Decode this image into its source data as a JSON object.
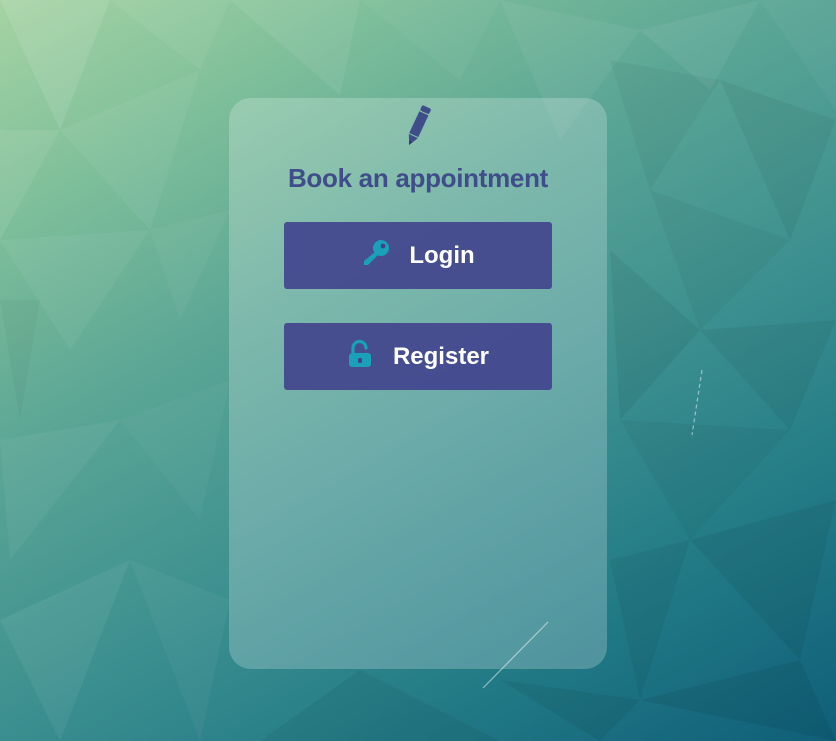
{
  "card": {
    "icon": "pencil-icon",
    "title": "Book an appointment"
  },
  "buttons": [
    {
      "label": "Login",
      "icon": "key-icon"
    },
    {
      "label": "Register",
      "icon": "unlock-icon"
    }
  ],
  "colors": {
    "title": "#3f4e8a",
    "button_bg": "#40408c",
    "button_text": "#ffffff",
    "icon_accent": "#1aa0b8"
  }
}
